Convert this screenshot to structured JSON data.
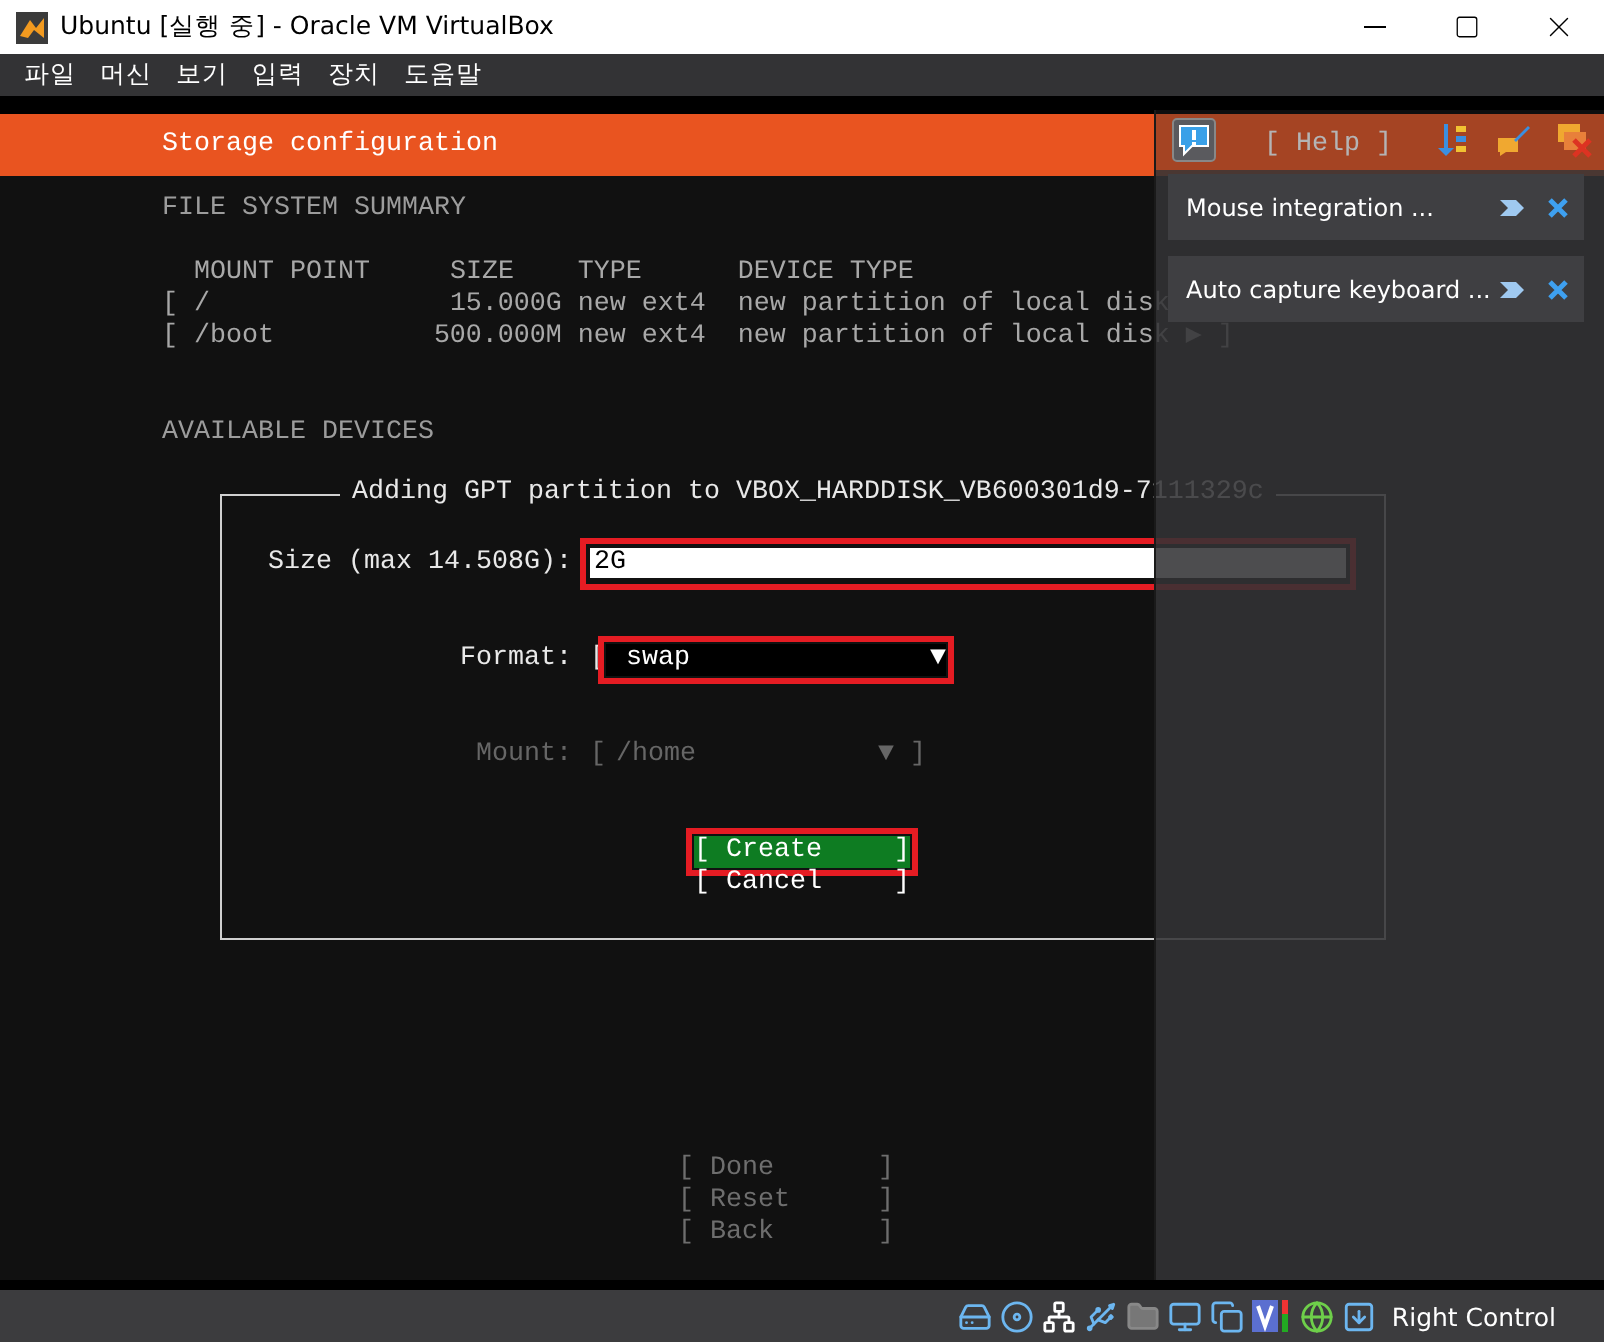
{
  "window": {
    "title": "Ubuntu [실행 중] - Oracle VM VirtualBox"
  },
  "menu": [
    "파일",
    "머신",
    "보기",
    "입력",
    "장치",
    "도움말"
  ],
  "screen": {
    "header": {
      "title": "Storage configuration",
      "help": "[ Help ]"
    },
    "summary": {
      "heading": "FILE SYSTEM SUMMARY",
      "columns": [
        "MOUNT POINT",
        "SIZE",
        "TYPE",
        "DEVICE TYPE"
      ],
      "rows": [
        {
          "mount": "[ /",
          "size": "15.000G",
          "type": "new ext4",
          "device_type": "new partition of local disk"
        },
        {
          "mount": "[ /boot",
          "size": "500.000M",
          "type": "new ext4",
          "device_type": "new partition of local disk ▶ ]"
        }
      ]
    },
    "available_heading": "AVAILABLE DEVICES",
    "dialog": {
      "title": "Adding GPT partition to VBOX_HARDDISK_VB600301d9-7111329c",
      "fields": [
        {
          "kind": "text",
          "label": "Size (max 14.508G):",
          "value": "2G",
          "highlighted": true,
          "disabled": false
        },
        {
          "kind": "select",
          "label": "Format:",
          "open": "[",
          "value": "swap",
          "arrow": "▼",
          "highlighted": true,
          "disabled": false
        },
        {
          "kind": "select",
          "label": "Mount:",
          "open": "[",
          "value": "/home",
          "arrow": "▼",
          "close": "]",
          "highlighted": false,
          "disabled": true
        }
      ],
      "buttons": [
        {
          "open": "[",
          "label": "Create",
          "close": "]",
          "selected": true,
          "highlighted": true
        },
        {
          "open": "[",
          "label": "Cancel",
          "close": "]",
          "selected": false,
          "highlighted": false
        }
      ]
    },
    "actions": [
      {
        "open": "[",
        "label": "Done",
        "close": "]",
        "disabled": true
      },
      {
        "open": "[",
        "label": "Reset",
        "close": "]",
        "disabled": true
      },
      {
        "open": "[",
        "label": "Back",
        "close": "]",
        "disabled": true
      }
    ]
  },
  "notifications": [
    {
      "text": "Mouse integration ..."
    },
    {
      "text": "Auto capture keyboard ..."
    }
  ],
  "status_bar": {
    "host_key": "Right Control"
  }
}
